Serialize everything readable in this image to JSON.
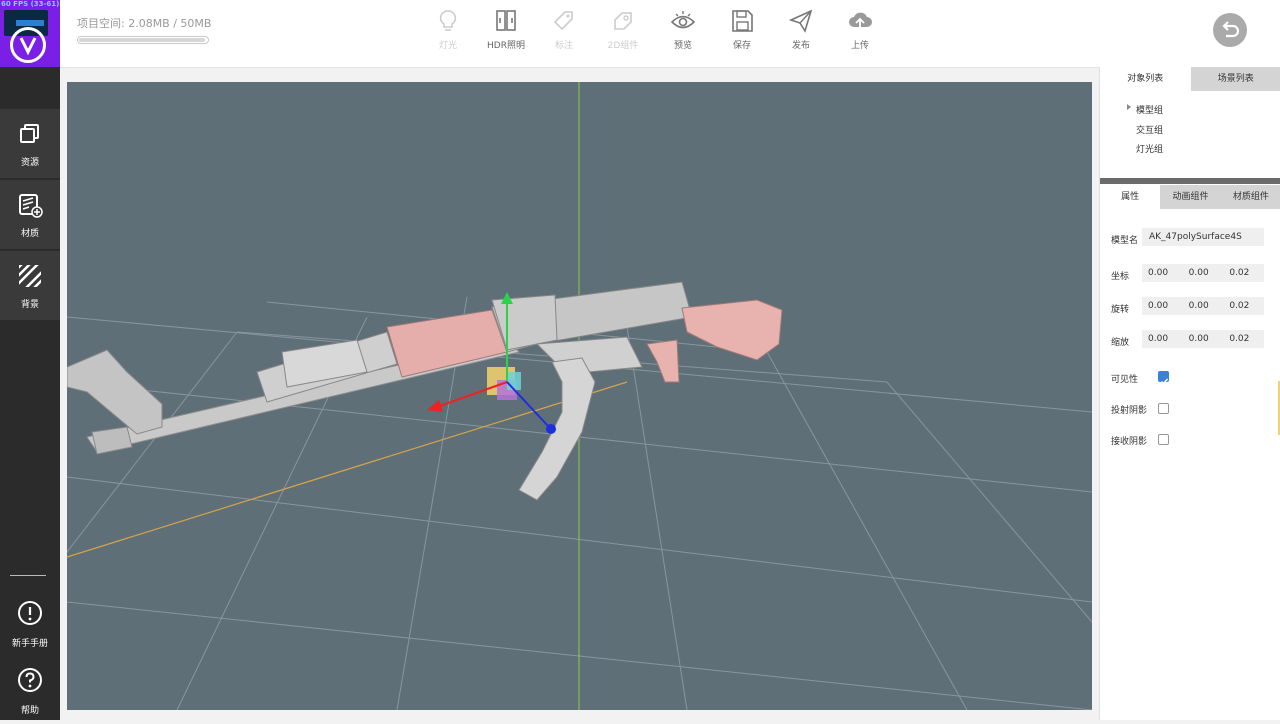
{
  "overlay": {
    "fps_text": "60 FPS (33-61)"
  },
  "sidebar": {
    "items": [
      {
        "label": "资源",
        "icon": "resources-icon"
      },
      {
        "label": "材质",
        "icon": "material-icon"
      },
      {
        "label": "背景",
        "icon": "background-icon"
      }
    ],
    "bottom": [
      {
        "label": "新手手册",
        "icon": "info-icon"
      },
      {
        "label": "帮助",
        "icon": "help-icon"
      }
    ]
  },
  "header": {
    "space_label": "项目空间: 2.08MB / 50MB",
    "space_usage": 0.04,
    "tools": [
      {
        "label": "灯光",
        "icon": "bulb-icon",
        "enabled": false
      },
      {
        "label": "HDR照明",
        "icon": "hdr-icon",
        "enabled": true
      },
      {
        "label": "标注",
        "icon": "tag-icon",
        "enabled": false
      },
      {
        "label": "2D组件",
        "icon": "component-icon",
        "enabled": false
      },
      {
        "label": "预览",
        "icon": "eye-icon",
        "enabled": true
      },
      {
        "label": "保存",
        "icon": "save-icon",
        "enabled": true
      },
      {
        "label": "发布",
        "icon": "send-icon",
        "enabled": true
      },
      {
        "label": "上传",
        "icon": "upload-icon",
        "enabled": true
      }
    ],
    "back_icon": "back-icon"
  },
  "colors": {
    "viewport_bg": "#5f6f78",
    "brand": "#7a1fe6",
    "stock": "#e8b2ae",
    "metal": "#c9c9c9",
    "checkbox": "#3b82d6"
  },
  "panel": {
    "top_tabs": [
      "对象列表",
      "场景列表"
    ],
    "tree": [
      "模型组",
      "交互组",
      "灯光组"
    ],
    "bottom_tabs": [
      "属性",
      "动画组件",
      "材质组件"
    ],
    "name_label": "模型名",
    "name_value": "AK_47polySurface4S",
    "transform": [
      {
        "label": "坐标",
        "values": [
          "0.00",
          "0.00",
          "0.02"
        ]
      },
      {
        "label": "旋转",
        "values": [
          "0.00",
          "0.00",
          "0.02"
        ]
      },
      {
        "label": "缩放",
        "values": [
          "0.00",
          "0.00",
          "0.02"
        ]
      }
    ],
    "checks": [
      {
        "label": "可见性",
        "checked": true
      },
      {
        "label": "投射阴影",
        "checked": false
      },
      {
        "label": "接收阴影",
        "checked": false
      }
    ]
  }
}
